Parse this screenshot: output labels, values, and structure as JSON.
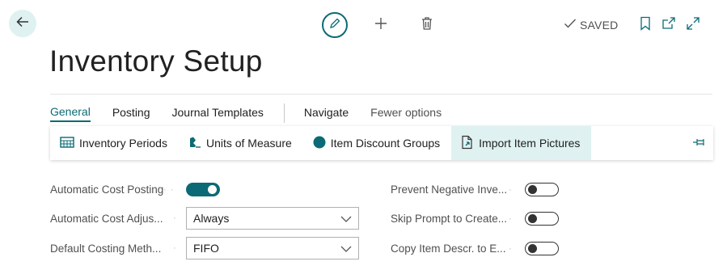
{
  "header": {
    "saved_label": "SAVED"
  },
  "page": {
    "title": "Inventory Setup"
  },
  "tabs": [
    {
      "label": "General"
    },
    {
      "label": "Posting"
    },
    {
      "label": "Journal Templates"
    },
    {
      "label": "Navigate"
    },
    {
      "label": "Fewer options"
    }
  ],
  "actions": [
    {
      "label": "Inventory Periods",
      "icon": "calendar-grid-icon"
    },
    {
      "label": "Units of Measure",
      "icon": "units-of-measure-icon"
    },
    {
      "label": "Item Discount Groups",
      "icon": "circle-icon"
    },
    {
      "label": "Import Item Pictures",
      "icon": "import-document-icon"
    }
  ],
  "fields_left": [
    {
      "label": "Automatic Cost Posting",
      "type": "toggle",
      "value": true
    },
    {
      "label": "Automatic Cost Adjus...",
      "type": "select",
      "value": "Always"
    },
    {
      "label": "Default Costing Meth...",
      "type": "select",
      "value": "FIFO"
    }
  ],
  "fields_right": [
    {
      "label": "Prevent Negative Inve...",
      "type": "toggle",
      "value": false
    },
    {
      "label": "Skip Prompt to Create...",
      "type": "toggle",
      "value": false
    },
    {
      "label": "Copy Item Descr. to E...",
      "type": "toggle",
      "value": false
    }
  ],
  "colors": {
    "accent": "#0b6a75",
    "highlight": "#dff1f1"
  }
}
